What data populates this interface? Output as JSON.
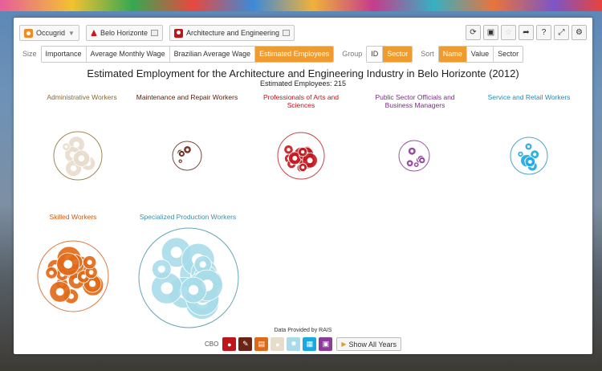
{
  "toolbar": {
    "occupation_label": "Occugrid",
    "location_label": "Belo Horizonte",
    "industry_label": "Architecture and Engineering"
  },
  "controls": {
    "size_label": "Size",
    "size_options": [
      "Importance",
      "Average Monthly Wage",
      "Brazilian Average Wage",
      "Estimated Employees"
    ],
    "group_label": "Group",
    "group_options": [
      "ID",
      "Sector"
    ],
    "sort_label": "Sort",
    "sort_options": [
      "Name",
      "Value",
      "Sector"
    ]
  },
  "chart": {
    "title": "Estimated Employment for the Architecture and Engineering Industry in Belo Horizonte (2012)",
    "subtitle": "Estimated Employees: 215",
    "groups": [
      {
        "label": "Administrative Workers",
        "color": "#8a6a2b",
        "fill": "#e8dccb"
      },
      {
        "label": "Maintenance and Repair Workers",
        "color": "#5c1a0c",
        "fill": "#6b2414"
      },
      {
        "label": "Professionals of Arts and Sciences",
        "color": "#c0141b",
        "fill": "#c7161d"
      },
      {
        "label": "Public Sector Officials and Business Managers",
        "color": "#7b2a86",
        "fill": "#8e3a9a"
      },
      {
        "label": "Service and Retail Workers",
        "color": "#1a8fc4",
        "fill": "#18a9e2"
      },
      {
        "label": "Skilled Workers",
        "color": "#d45a10",
        "fill": "#e06916"
      },
      {
        "label": "Specialized Production Workers",
        "color": "#3f8fa8",
        "fill": "#a9dbe9"
      }
    ]
  },
  "footer": {
    "data_note": "Data Provided by RAIS",
    "cbo_label": "CBO",
    "show_years_label": "Show All Years"
  }
}
